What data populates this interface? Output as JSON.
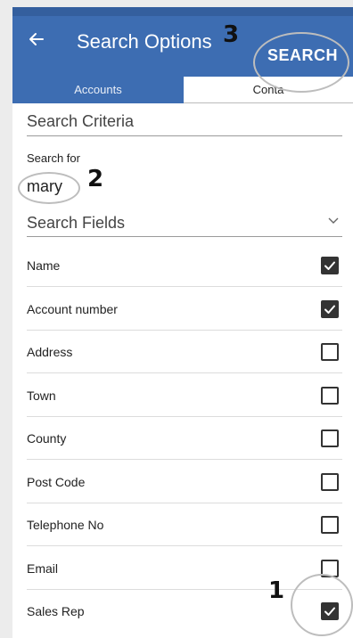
{
  "appbar": {
    "back_icon": "arrow-left-icon",
    "title": "Search Options",
    "search_label": "SEARCH"
  },
  "tabs": [
    {
      "label": "Accounts",
      "active": true
    },
    {
      "label": "Conta",
      "active": false
    }
  ],
  "criteria": {
    "title": "Search Criteria",
    "search_for_label": "Search for",
    "search_for_value": "mary"
  },
  "fields": {
    "title": "Search Fields",
    "items": [
      {
        "label": "Name",
        "checked": true
      },
      {
        "label": "Account number",
        "checked": true
      },
      {
        "label": "Address",
        "checked": false
      },
      {
        "label": "Town",
        "checked": false
      },
      {
        "label": "County",
        "checked": false
      },
      {
        "label": "Post Code",
        "checked": false
      },
      {
        "label": "Telephone No",
        "checked": false
      },
      {
        "label": "Email",
        "checked": false
      },
      {
        "label": "Sales Rep",
        "checked": true
      }
    ]
  },
  "annotations": {
    "one": "1",
    "two": "2",
    "three": "3"
  },
  "colors": {
    "appbar": "#3d6db2",
    "background": "#ececec"
  }
}
